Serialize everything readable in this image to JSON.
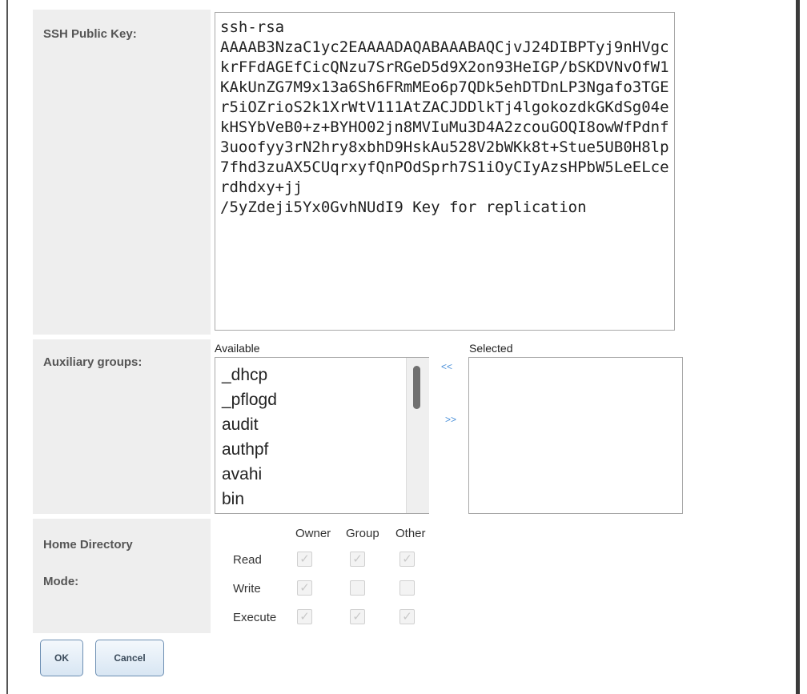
{
  "ssh": {
    "label": "SSH Public Key:",
    "value": "ssh-rsa\nAAAAB3NzaC1yc2EAAAADAQABAAABAQCjvJ24DIBPTyj9nHVgckrFFdAGEfCicQNzu7SrRGeD5d9X2on93HeIGP/bSKDVNvOfW1KAkUnZG7M9x13a6Sh6FRmMEo6p7QDk5ehDTDnLP3Ngafo3TGEr5iOZrioS2k1XrWtV111AtZACJDDlkTj4lgokozdkGKdSg04ekHSYbVeB0+z+BYHO02jn8MVIuMu3D4A2zcouGOQI8owWfPdnf3uoofyy3rN2hry8xbhD9HskAu528V2bWKk8t+Stue5UB0H8lp7fhd3zuAX5CUqrxyfQnPOdSprh7S1iOyCIyAzsHPbW5LeELcerdhdxy+jj\n/5yZdeji5Yx0GvhNUdI9 Key for replication"
  },
  "aux": {
    "label": "Auxiliary groups:",
    "available_heading": "Available",
    "selected_heading": "Selected",
    "available_items": [
      "_dhcp",
      "_pflogd",
      "audit",
      "authpf",
      "avahi",
      "bin"
    ],
    "move_left": "<<",
    "move_right": ">>"
  },
  "home": {
    "label_line1": "Home Directory",
    "label_line2": "Mode:",
    "columns": [
      "Owner",
      "Group",
      "Other"
    ],
    "rows": [
      {
        "label": "Read",
        "owner": true,
        "group": true,
        "other": true
      },
      {
        "label": "Write",
        "owner": true,
        "group": false,
        "other": false
      },
      {
        "label": "Execute",
        "owner": true,
        "group": true,
        "other": true
      }
    ]
  },
  "buttons": {
    "ok": "OK",
    "cancel": "Cancel"
  },
  "colors": {
    "label_bg": "#eeeeee",
    "button_border": "#6d8fb3",
    "link": "#4a90d9"
  }
}
